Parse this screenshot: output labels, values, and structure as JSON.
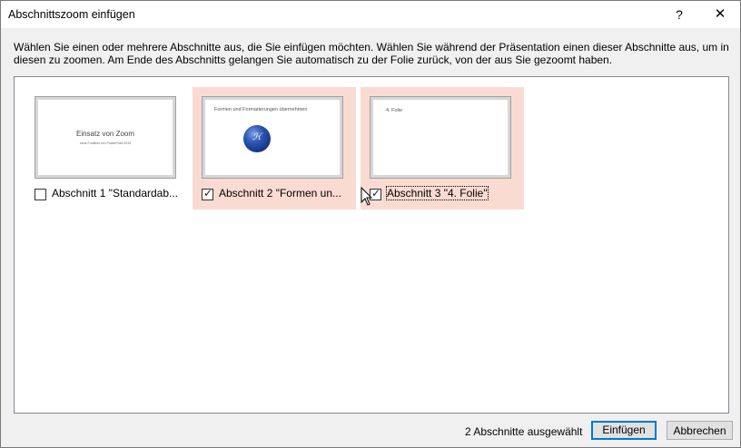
{
  "window": {
    "title": "Abschnittszoom einfügen",
    "help_label": "?",
    "close_label": "✕"
  },
  "intro_text": "Wählen Sie einen oder mehrere Abschnitte aus, die Sie einfügen möchten. Wählen Sie während der Präsentation einen dieser Abschnitte aus, um in diesen zu zoomen. Am Ende des Abschnitts gelangen Sie automatisch zu der Folie zurück, von der aus Sie gezoomt haben.",
  "sections": [
    {
      "label": "Abschnitt 1 \"Standardab...",
      "checked": false,
      "thumb_title": "Einsatz von Zoom",
      "thumb_subtitle": "neue Funktion von PowerPoint 2019"
    },
    {
      "label": "Abschnitt 2 \"Formen un...",
      "checked": true,
      "thumb_title": "Formen und Formatierungen übernehmen",
      "thumb_logo_text": "ℋ"
    },
    {
      "label": "Abschnitt 3 \"4. Folie\"",
      "checked": true,
      "thumb_title": "4. Folie"
    }
  ],
  "status_text": "2 Abschnitte ausgewählt",
  "buttons": {
    "insert": "Einfügen",
    "cancel": "Abbrechen"
  },
  "colors": {
    "selected_bg": "#fadbd2",
    "accent": "#0078d7"
  }
}
